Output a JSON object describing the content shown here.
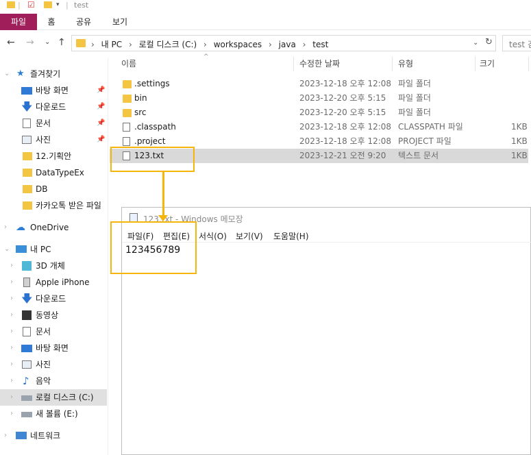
{
  "window": {
    "title": "test"
  },
  "ribbon": {
    "tabs": [
      "파일",
      "홈",
      "공유",
      "보기"
    ]
  },
  "address": {
    "path": [
      "내 PC",
      "로컬 디스크 (C:)",
      "workspaces",
      "java",
      "test"
    ],
    "search_placeholder": "test 검색"
  },
  "sidebar": {
    "quick_access": "즐겨찾기",
    "items": [
      {
        "label": "바탕 화면",
        "icon": "desktop-icon",
        "pinned": true
      },
      {
        "label": "다운로드",
        "icon": "download-icon",
        "pinned": true
      },
      {
        "label": "문서",
        "icon": "document-icon",
        "pinned": true
      },
      {
        "label": "사진",
        "icon": "picture-icon",
        "pinned": true
      },
      {
        "label": "12.기획안",
        "icon": "folder-icon"
      },
      {
        "label": "DataTypeEx",
        "icon": "folder-icon"
      },
      {
        "label": "DB",
        "icon": "folder-icon"
      },
      {
        "label": "카카오톡 받은 파일",
        "icon": "folder-icon"
      }
    ],
    "onedrive": "OneDrive",
    "this_pc": "내 PC",
    "pc_items": [
      {
        "label": "3D 개체",
        "icon": "cube-icon"
      },
      {
        "label": "Apple iPhone",
        "icon": "phone-icon"
      },
      {
        "label": "다운로드",
        "icon": "download-icon"
      },
      {
        "label": "동영상",
        "icon": "video-icon"
      },
      {
        "label": "문서",
        "icon": "document-icon"
      },
      {
        "label": "바탕 화면",
        "icon": "desktop-icon"
      },
      {
        "label": "사진",
        "icon": "picture-icon"
      },
      {
        "label": "음악",
        "icon": "music-icon"
      },
      {
        "label": "로컬 디스크 (C:)",
        "icon": "drive-icon",
        "selected": true
      },
      {
        "label": "새 볼륨 (E:)",
        "icon": "drive-icon"
      }
    ],
    "network": "네트워크"
  },
  "files": {
    "columns": [
      "이름",
      "수정한 날짜",
      "유형",
      "크기"
    ],
    "rows": [
      {
        "name": ".settings",
        "date": "2023-12-18 오후 12:08",
        "type": "파일 폴더",
        "size": "",
        "kind": "folder"
      },
      {
        "name": "bin",
        "date": "2023-12-20 오후 5:15",
        "type": "파일 폴더",
        "size": "",
        "kind": "folder"
      },
      {
        "name": "src",
        "date": "2023-12-20 오후 5:15",
        "type": "파일 폴더",
        "size": "",
        "kind": "folder"
      },
      {
        "name": ".classpath",
        "date": "2023-12-18 오후 12:08",
        "type": "CLASSPATH 파일",
        "size": "1KB",
        "kind": "file"
      },
      {
        "name": ".project",
        "date": "2023-12-18 오후 12:08",
        "type": "PROJECT 파일",
        "size": "1KB",
        "kind": "file"
      },
      {
        "name": "123.txt",
        "date": "2023-12-21 오전 9:20",
        "type": "텍스트 문서",
        "size": "1KB",
        "kind": "txt",
        "selected": true
      }
    ]
  },
  "notepad": {
    "title": "123.txt - Windows 메모장",
    "menu": [
      "파일(F)",
      "편집(E)",
      "서식(O)",
      "보기(V)",
      "도움말(H)"
    ],
    "content": "123456789"
  },
  "colors": {
    "accent": "#a01e5a",
    "highlight": "#f5b50a",
    "folder": "#f4c542"
  }
}
